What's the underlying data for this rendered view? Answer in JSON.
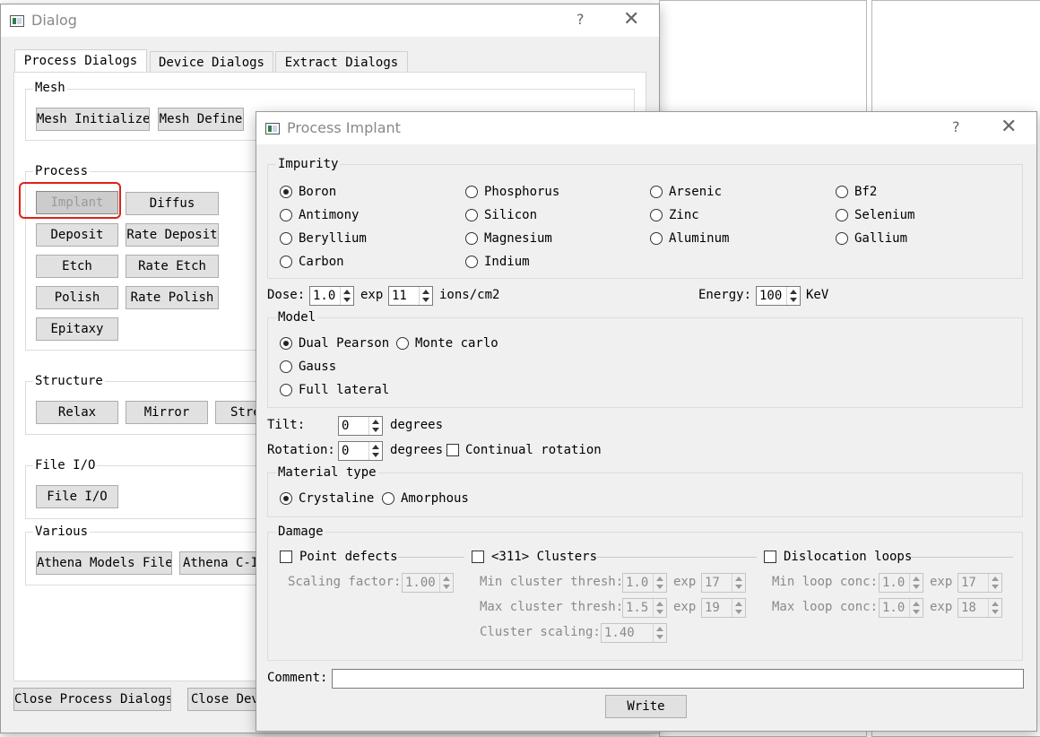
{
  "dialog": {
    "title": "Dialog",
    "help": "?",
    "close": "✕",
    "tabs": [
      "Process Dialogs",
      "Device Dialogs",
      "Extract Dialogs"
    ],
    "groups": {
      "mesh": "Mesh",
      "process": "Process",
      "structure": "Structure",
      "fileio": "File I/O",
      "various": "Various"
    },
    "buttons": {
      "mesh_initialize": "Mesh Initialize",
      "mesh_define": "Mesh Define",
      "implant": "Implant",
      "diffus": "Diffus",
      "deposit": "Deposit",
      "rate_deposit": "Rate Deposit",
      "etch": "Etch",
      "rate_etch": "Rate Etch",
      "polish": "Polish",
      "rate_polish": "Rate Polish",
      "epitaxy": "Epitaxy",
      "relax": "Relax",
      "mirror": "Mirror",
      "stretch": "Stre",
      "file_io": "File I/O",
      "athena_models_file": "Athena Models File",
      "athena_c_interp": "Athena C-In",
      "close_process_dialogs": "Close Process Dialogs",
      "close_device": "Close Dev"
    }
  },
  "implant": {
    "title": "Process Implant",
    "help": "?",
    "close": "✕",
    "impurity": {
      "label": "Impurity",
      "options": [
        [
          "Boron",
          "Phosphorus",
          "Arsenic",
          "Bf2"
        ],
        [
          "Antimony",
          "Silicon",
          "Zinc",
          "Selenium"
        ],
        [
          "Beryllium",
          "Magnesium",
          "Aluminum",
          "Gallium"
        ],
        [
          "Carbon",
          "Indium"
        ]
      ],
      "selected": "Boron"
    },
    "dose": {
      "label": "Dose:",
      "mantissa": "1.0",
      "exp_label": "exp",
      "exp": "11",
      "unit": "ions/cm2"
    },
    "energy": {
      "label": "Energy:",
      "value": "100",
      "unit": "KeV"
    },
    "model": {
      "label": "Model",
      "options": [
        "Dual Pearson",
        "Monte carlo",
        "Gauss",
        "Full lateral"
      ],
      "selected": "Dual Pearson"
    },
    "tilt": {
      "label": "Tilt:",
      "value": "0",
      "unit": "degrees"
    },
    "rotation": {
      "label": "Rotation:",
      "value": "0",
      "unit": "degrees",
      "continual_label": "Continual rotation"
    },
    "material": {
      "label": "Material type",
      "options": [
        "Crystaline",
        "Amorphous"
      ],
      "selected": "Crystaline"
    },
    "damage": {
      "label": "Damage",
      "point_defects": "Point defects",
      "clusters": "<311> Clusters",
      "dislocation_loops": "Dislocation loops",
      "scaling_factor_label": "Scaling factor:",
      "scaling_factor": "1.00",
      "min_cluster_label": "Min cluster thresh:",
      "min_cluster": "1.0",
      "min_cluster_exp": "17",
      "max_cluster_label": "Max cluster thresh:",
      "max_cluster": "1.5",
      "max_cluster_exp": "19",
      "cluster_scaling_label": "Cluster scaling:",
      "cluster_scaling": "1.40",
      "min_loop_label": "Min loop conc:",
      "min_loop": "1.0",
      "min_loop_exp": "17",
      "max_loop_label": "Max loop conc:",
      "max_loop": "1.0",
      "max_loop_exp": "18",
      "exp_label": "exp"
    },
    "comment": {
      "label": "Comment:",
      "value": ""
    },
    "write_button": "Write"
  },
  "colors": {
    "highlight": "#e0201a",
    "window_bg": "#f0f0f0",
    "button_bg": "#e1e1e1"
  }
}
